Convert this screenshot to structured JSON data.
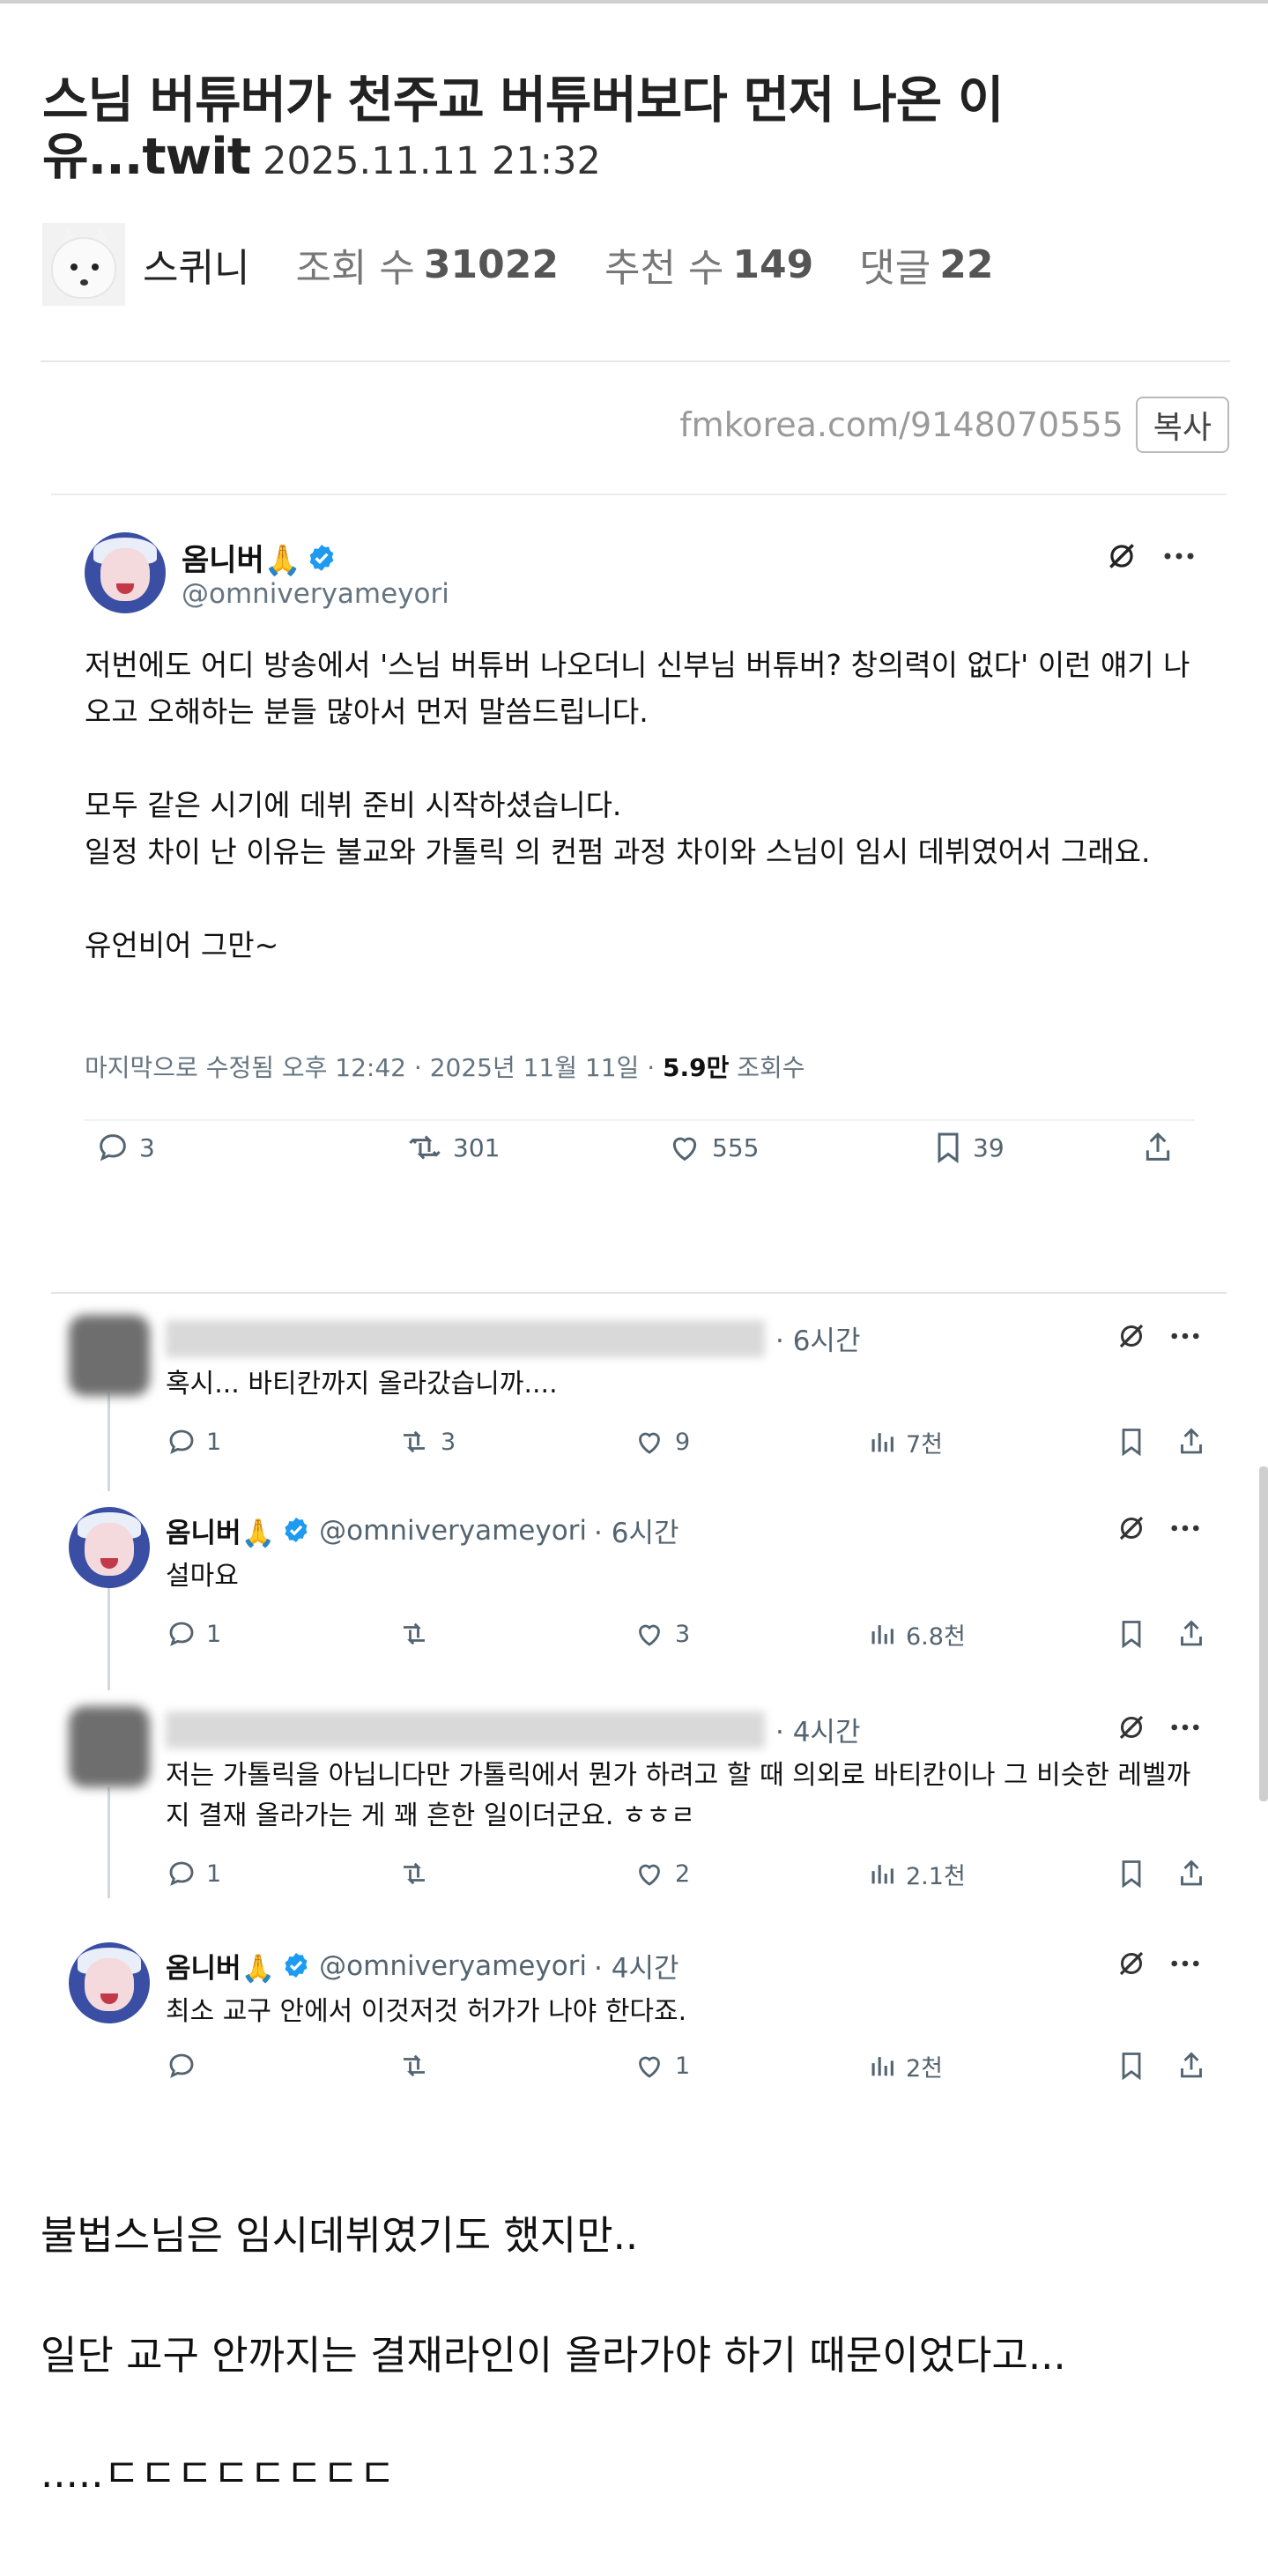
{
  "post": {
    "title": "스님 버튜버가 천주교 버튜버보다 먼저 나온 이유...twit",
    "datetime": "2025.11.11 21:32",
    "author": "스퀴니",
    "views_label": "조회 수",
    "views": "31022",
    "recommend_label": "추천 수",
    "recommend": "149",
    "comments_label": "댓글",
    "comments": "22",
    "url": "fmkorea.com/9148070555",
    "copy_label": "복사"
  },
  "tweet": {
    "name": "옴니버🙏",
    "handle": "@omniveryameyori",
    "body": "저번에도 어디 방송에서 '스님 버튜버 나오더니 신부님 버튜버? 창의력이 없다' 이런 얘기 나오고 오해하는 분들 많아서 먼저 말씀드립니다.\n\n모두 같은 시기에 데뷔 준비 시작하셨습니다.\n일정 차이 난 이유는 불교와 가톨릭 의 컨펌 과정 차이와 스님이 임시 데뷔였어서 그래요.\n\n유언비어 그만~",
    "footer_prefix": "마지막으로 수정됨 오후 12:42 · 2025년 11월 11일 · ",
    "footer_views": "5.9만",
    "footer_suffix": " 조회수",
    "replies": "3",
    "retweets": "301",
    "likes": "555",
    "bookmarks": "39"
  },
  "replies": [
    {
      "name": "",
      "handle": "",
      "time": "· 6시간",
      "text": "혹시... 바티칸까지 올라갔습니까....",
      "replies": "1",
      "retweets": "3",
      "likes": "9",
      "views": "7천"
    },
    {
      "name": "옴니버🙏",
      "handle": "@omniveryameyori",
      "time": "· 6시간",
      "text": "설마요",
      "replies": "1",
      "retweets": "",
      "likes": "3",
      "views": "6.8천"
    },
    {
      "name": "",
      "handle": "",
      "time": "· 4시간",
      "text": "저는 가톨릭을 아닙니다만 가톨릭에서 뭔가 하려고 할 때 의외로 바티칸이나 그 비슷한 레벨까지 결재 올라가는 게 꽤 흔한 일이더군요. ㅎㅎㄹ",
      "replies": "1",
      "retweets": "",
      "likes": "2",
      "views": "2.1천"
    },
    {
      "name": "옴니버🙏",
      "handle": "@omniveryameyori",
      "time": "· 4시간",
      "text": "최소 교구 안에서 이것저것 허가가 나야 한다죠.",
      "replies": "",
      "retweets": "",
      "likes": "1",
      "views": "2천"
    }
  ],
  "body_lines": [
    "불법스님은 임시데뷔였기도 했지만..",
    " 일단 교구 안까지는 결재라인이 올라가야 하기 때문이었다고...",
    ".....ㄷㄷㄷㄷㄷㄷㄷㄷ"
  ],
  "colors": {
    "verified": "#1d9bf0",
    "muted": "#536471"
  }
}
